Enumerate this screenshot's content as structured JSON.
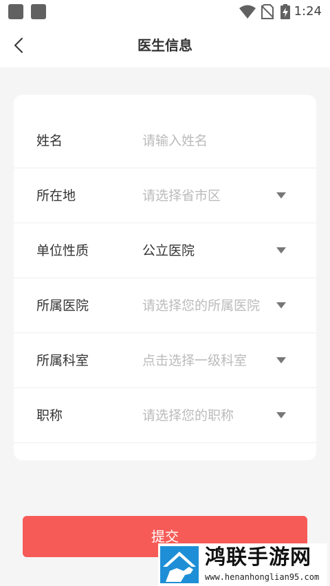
{
  "status_bar": {
    "time": "1:24",
    "icons": [
      "notification-square-icon",
      "notification-square-icon",
      "wifi-icon",
      "no-sim-icon",
      "battery-charging-icon"
    ]
  },
  "nav": {
    "back_icon": "chevron-left-icon",
    "title": "医生信息"
  },
  "form": {
    "rows": [
      {
        "label": "姓名",
        "placeholder": "请输入姓名",
        "value": "",
        "type": "input"
      },
      {
        "label": "所在地",
        "placeholder": "请选择省市区",
        "value": "",
        "type": "select"
      },
      {
        "label": "单位性质",
        "placeholder": "",
        "value": "公立医院",
        "type": "select"
      },
      {
        "label": "所属医院",
        "placeholder": "请选择您的所属医院",
        "value": "",
        "type": "select"
      },
      {
        "label": "所属科室",
        "placeholder": "点击选择一级科室",
        "value": "",
        "type": "select"
      },
      {
        "label": "职称",
        "placeholder": "请选择您的职称",
        "value": "",
        "type": "select"
      }
    ]
  },
  "submit": {
    "label": "提交"
  },
  "watermark": {
    "name": "鸿联手游网",
    "url": "www.henanhonglian95.com"
  },
  "colors": {
    "accent": "#f65b57",
    "background": "#f5f5f5",
    "placeholder": "#bbbbbb",
    "text": "#333333"
  }
}
